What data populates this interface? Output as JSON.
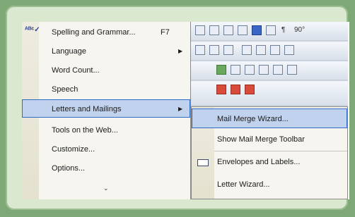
{
  "menu": {
    "items": [
      {
        "label": "Spelling and Grammar...",
        "shortcut": "F7",
        "submenu": false,
        "icon": "spelling-icon"
      },
      {
        "label": "Language",
        "shortcut": "",
        "submenu": true
      },
      {
        "label": "Word Count...",
        "shortcut": "",
        "submenu": false
      },
      {
        "label": "Speech",
        "shortcut": "",
        "submenu": false
      },
      {
        "label": "Letters and Mailings",
        "shortcut": "",
        "submenu": true,
        "highlighted": true
      },
      {
        "label": "Tools on the Web...",
        "shortcut": "",
        "submenu": false
      },
      {
        "label": "Customize...",
        "shortcut": "",
        "submenu": false
      },
      {
        "label": "Options...",
        "shortcut": "",
        "submenu": false
      }
    ],
    "expand_glyph": "⌄"
  },
  "submenu": {
    "items": [
      {
        "label": "Mail Merge Wizard...",
        "highlighted": true
      },
      {
        "label": "Show Mail Merge Toolbar"
      },
      {
        "label": "Envelopes and Labels...",
        "icon": "envelope-icon"
      },
      {
        "label": "Letter Wizard..."
      }
    ]
  },
  "toolbar": {
    "pilcrow": "¶",
    "zoom": "90°"
  },
  "colors": {
    "highlight": "#c1d2ee",
    "highlight_border": "#316ac5",
    "frame": "#d9e8cf",
    "background": "#7fa877"
  }
}
